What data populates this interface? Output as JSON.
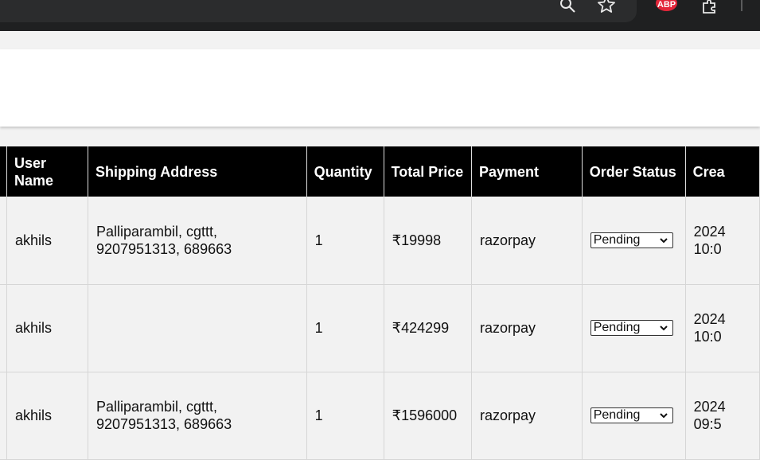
{
  "table": {
    "headers": {
      "user_name": "User Name",
      "shipping_address": "Shipping Address",
      "quantity": "Quantity",
      "total_price": "Total Price",
      "payment": "Payment",
      "order_status": "Order Status",
      "created": "Crea"
    },
    "rows": [
      {
        "user_name": "akhils",
        "shipping_address": "Palliparambil, cgttt, 9207951313, 689663",
        "quantity": "1",
        "total_price": "₹19998",
        "payment": "razorpay",
        "status": "Pending",
        "created_line1": "2024",
        "created_line2": "10:0"
      },
      {
        "user_name": "akhils",
        "shipping_address": "",
        "quantity": "1",
        "total_price": "₹424299",
        "payment": "razorpay",
        "status": "Pending",
        "created_line1": "2024",
        "created_line2": "10:0"
      },
      {
        "user_name": "akhils",
        "shipping_address": "Palliparambil, cgttt, 9207951313, 689663",
        "quantity": "1",
        "total_price": "₹1596000",
        "payment": "razorpay",
        "status": "Pending",
        "created_line1": "2024",
        "created_line2": "09:5"
      }
    ]
  },
  "browser": {
    "extension_badge": "ABP",
    "icons": [
      "search-icon",
      "star-icon",
      "adblock-icon",
      "extensions-icon"
    ]
  },
  "colors": {
    "header_bg": "#000000",
    "page_bg": "#f2f2f2",
    "adblock": "#e3263a"
  }
}
